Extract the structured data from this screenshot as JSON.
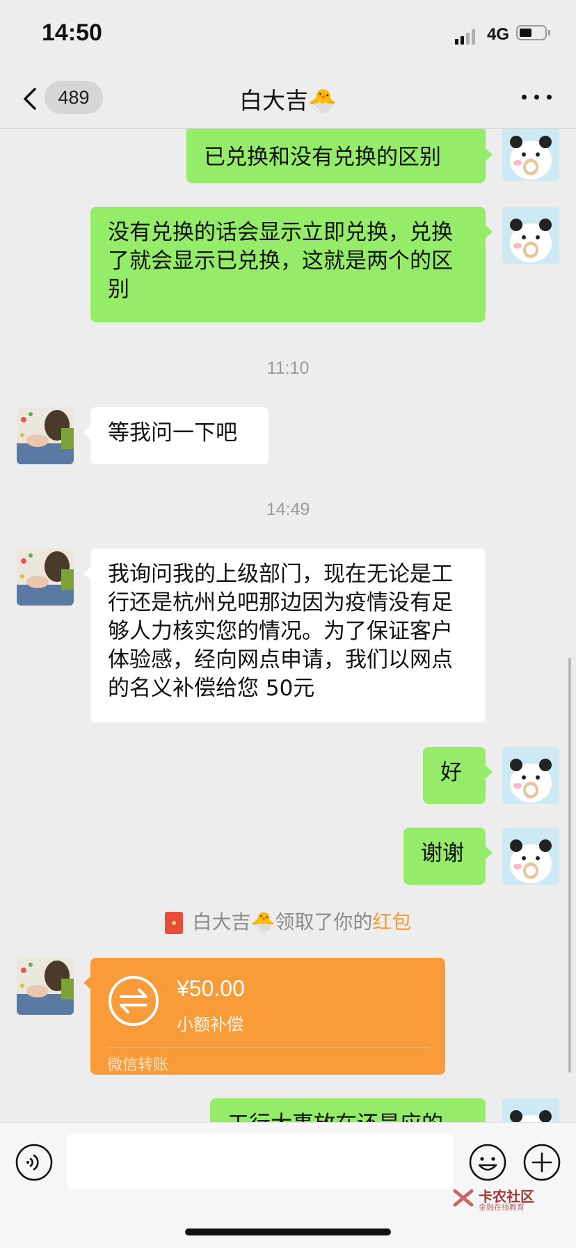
{
  "status_bar": {
    "time": "14:50",
    "network": "4G"
  },
  "header": {
    "unread_count": "489",
    "title": "白大吉🐣"
  },
  "messages": [
    {
      "from": "me",
      "text": "已兑换和没有兑换的区别"
    },
    {
      "from": "me",
      "text": "没有兑换的话会显示立即兑换，兑换了就会显示已兑换，这就是两个的区别"
    },
    {
      "from": "other",
      "text": "等我问一下吧"
    },
    {
      "from": "other",
      "text": "我询问我的上级部门，现在无论是工行还是杭州兑吧那边因为疫情没有足够人力核实您的情况。为了保证客户体验感，经向网点申请，我们以网点的名义补偿给您 50元"
    },
    {
      "from": "me",
      "text": "好"
    },
    {
      "from": "me",
      "text": "谢谢"
    },
    {
      "from": "me",
      "text": "工行大事放在还是应的"
    }
  ],
  "timestamps": [
    "11:10",
    "14:49"
  ],
  "system_message": {
    "prefix": "白大吉🐣领取了你的",
    "link": "红包"
  },
  "transfer": {
    "amount": "¥50.00",
    "note": "小额补偿",
    "type": "微信转账"
  },
  "watermark": {
    "main": "卡农社区",
    "sub": "金融在线教育"
  },
  "colors": {
    "my_bubble": "#95ec69",
    "other_bubble": "#ffffff",
    "transfer_card": "#f89c3a",
    "background": "#ededed",
    "link": "#f39c34"
  },
  "icons": [
    "back-chevron-icon",
    "more-icon",
    "voice-icon",
    "emoji-icon",
    "plus-icon",
    "red-packet-icon",
    "transfer-icon"
  ]
}
